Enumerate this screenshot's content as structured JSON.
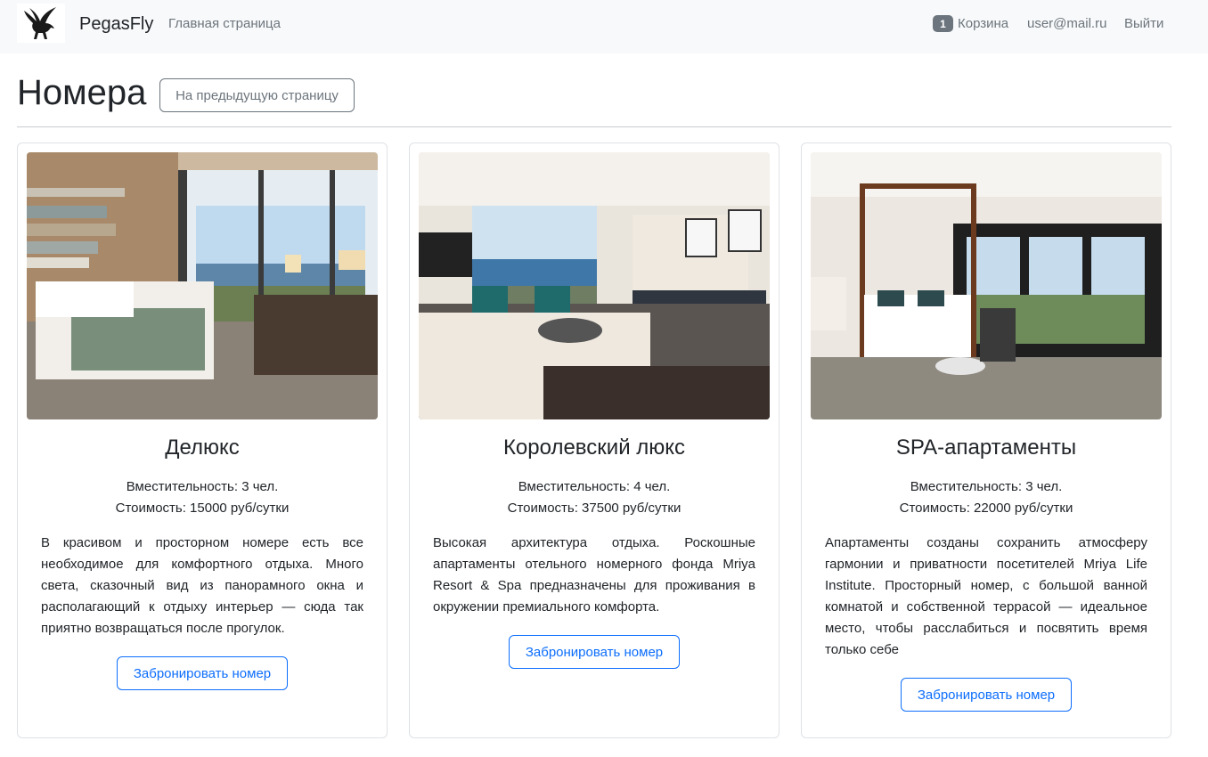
{
  "navbar": {
    "brand": "PegasFly",
    "home_link": "Главная страница",
    "cart_count": "1",
    "cart_label": "Корзина",
    "user_email": "user@mail.ru",
    "logout": "Выйти"
  },
  "header": {
    "title": "Номера",
    "back_button": "На предыдущую страницу"
  },
  "rooms": [
    {
      "title": "Делюкс",
      "capacity": "Вместительность: 3 чел.",
      "price": "Стоимость: 15000 руб/сутки",
      "description": "В красивом и просторном номере есть все необходимое для комфортного отдыха. Много света, сказочный вид из панорамного окна и располагающий к отдыху интерьер — сюда так приятно возвращаться после прогулок.",
      "button": "Забронировать номер"
    },
    {
      "title": "Королевский люкс",
      "capacity": "Вместительность: 4 чел.",
      "price": "Стоимость: 37500 руб/сутки",
      "description": "Высокая архитектура отдыха. Роскошные апартаменты отельного номерного фонда Mriya Resort & Spa предназначены для проживания в окружении премиального комфорта.",
      "button": "Забронировать номер"
    },
    {
      "title": "SPA-апартаменты",
      "capacity": "Вместительность: 3 чел.",
      "price": "Стоимость: 22000 руб/сутки",
      "description": "Апартаменты созданы сохранить атмосферу гармонии и приватности посетителей Mriya Life Institute. Просторный номер, с большой ванной комнатой и собственной террасой — идеальное место, чтобы расслабиться и посвятить время только себе",
      "button": "Забронировать номер"
    }
  ],
  "colors": {
    "primary": "#0d6efd",
    "secondary": "#6c757d",
    "navbar_bg": "#f8f9fa"
  },
  "icons": {
    "logo": "pegasus-logo-icon"
  }
}
